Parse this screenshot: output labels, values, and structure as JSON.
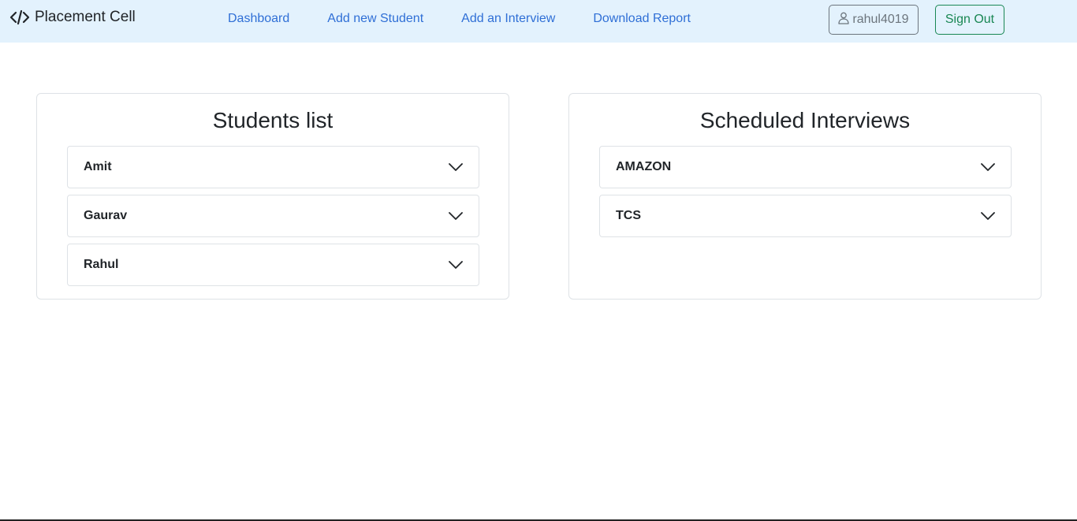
{
  "navbar": {
    "brand": "Placement Cell",
    "brand_icon": "code-icon",
    "links": [
      {
        "label": "Dashboard"
      },
      {
        "label": "Add new Student"
      },
      {
        "label": "Add an Interview"
      },
      {
        "label": "Download Report"
      }
    ],
    "user": {
      "label": "rahul4019",
      "icon": "person-icon"
    },
    "sign_out": "Sign Out"
  },
  "students": {
    "title": "Students list",
    "items": [
      {
        "label": "Amit"
      },
      {
        "label": "Gaurav"
      },
      {
        "label": "Rahul"
      }
    ]
  },
  "interviews": {
    "title": "Scheduled Interviews",
    "items": [
      {
        "label": "AMAZON"
      },
      {
        "label": "TCS"
      }
    ]
  },
  "colors": {
    "navbar_bg": "#e3f2fd",
    "link": "#2f6fd6",
    "secondary": "#6c757d",
    "success": "#198754"
  }
}
